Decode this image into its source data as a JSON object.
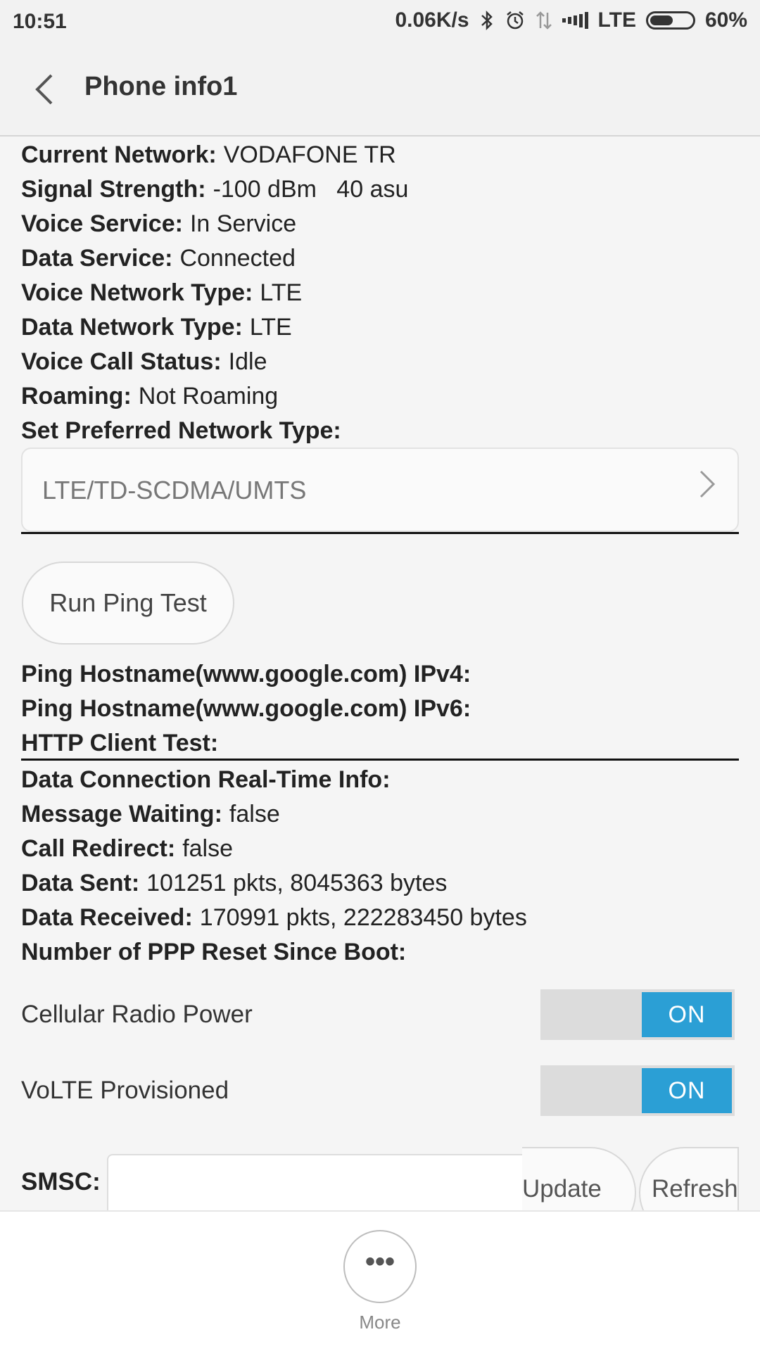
{
  "status_bar": {
    "time": "10:51",
    "net_speed": "0.06K/s",
    "network_type": "LTE",
    "battery": "60%",
    "battery_level": 0.6
  },
  "header": {
    "title": "Phone info1",
    "back_icon": "chevron-left-icon"
  },
  "info_rows": [
    {
      "label": "Current Network:",
      "value": "VODAFONE TR"
    },
    {
      "label": "Signal Strength:",
      "value": "-100 dBm   40 asu"
    },
    {
      "label": "Voice Service:",
      "value": "In Service"
    },
    {
      "label": "Data Service:",
      "value": "Connected"
    },
    {
      "label": "Voice Network Type:",
      "value": "LTE"
    },
    {
      "label": "Data Network Type:",
      "value": "LTE"
    },
    {
      "label": "Voice Call Status:",
      "value": "Idle"
    },
    {
      "label": "Roaming:",
      "value": "Not Roaming"
    },
    {
      "label": "Set Preferred Network Type:",
      "value": ""
    }
  ],
  "preferred_network": {
    "selected": "LTE/TD-SCDMA/UMTS"
  },
  "ping": {
    "button_label": "Run Ping Test",
    "rows": [
      {
        "label": "Ping Hostname(www.google.com) IPv4:",
        "value": ""
      },
      {
        "label": "Ping Hostname(www.google.com) IPv6:",
        "value": ""
      },
      {
        "label": "HTTP Client Test:",
        "value": ""
      }
    ]
  },
  "realtime_rows": [
    {
      "label": "Data Connection Real-Time Info:",
      "value": ""
    },
    {
      "label": "Message Waiting:",
      "value": "false"
    },
    {
      "label": "Call Redirect:",
      "value": "false"
    },
    {
      "label": "Data Sent:",
      "value": "101251 pkts, 8045363 bytes"
    },
    {
      "label": "Data Received:",
      "value": "170991 pkts, 222283450 bytes"
    },
    {
      "label": "Number of PPP Reset Since Boot:",
      "value": ""
    }
  ],
  "toggles": [
    {
      "label": "Cellular Radio Power",
      "state": "ON"
    },
    {
      "label": "VoLTE Provisioned",
      "state": "ON"
    }
  ],
  "smsc": {
    "label": "SMSC:",
    "value": "",
    "update_label": "Update",
    "refresh_label": "Refresh"
  },
  "bottom": {
    "more_icon": "more-horizontal-icon",
    "more_glyph": "•••",
    "more_label": "More"
  },
  "colors": {
    "accent": "#2b9fd5",
    "background": "#f5f5f5"
  }
}
